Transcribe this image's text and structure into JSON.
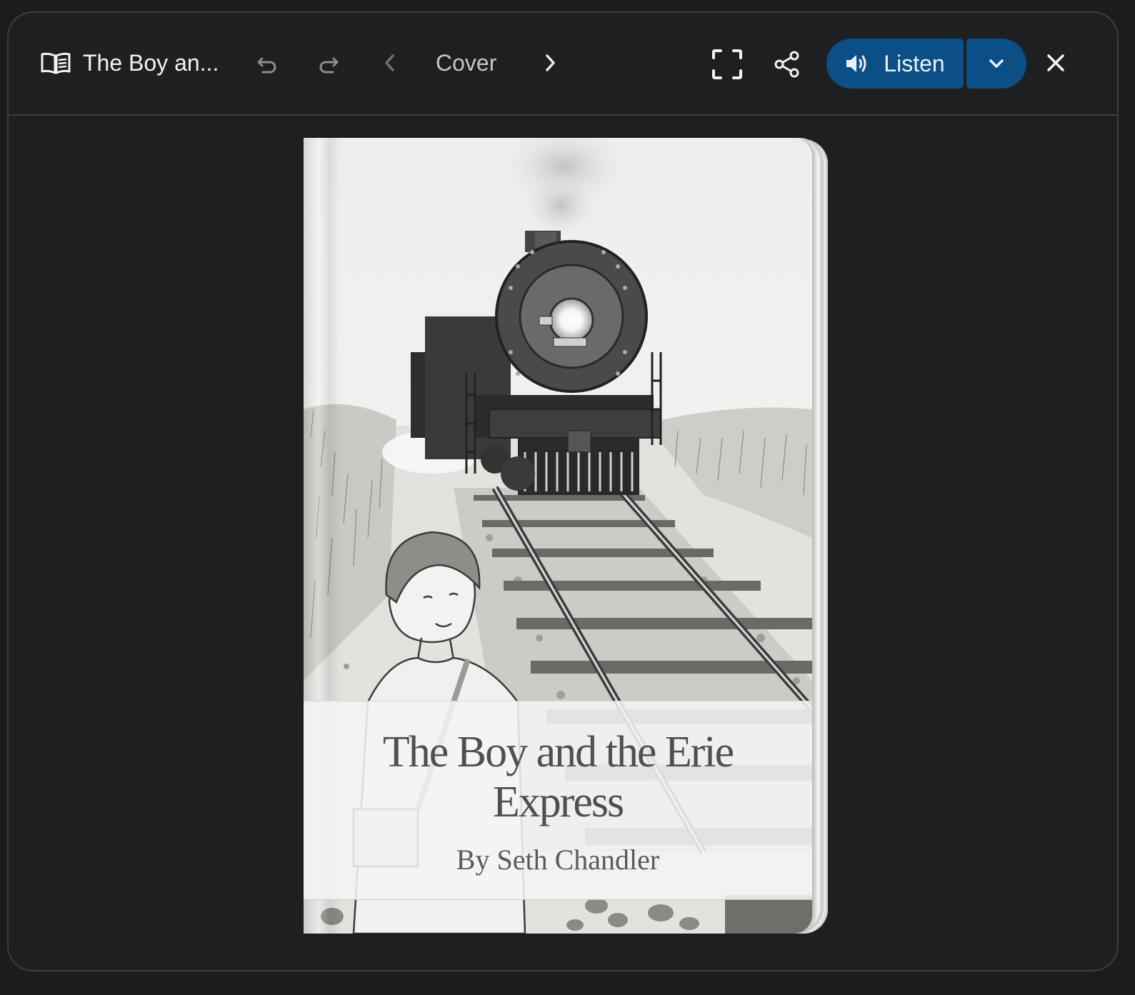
{
  "toolbar": {
    "book_title": "The Boy an...",
    "page_label": "Cover",
    "listen_label": "Listen",
    "icons": {
      "book": "open-book-icon",
      "undo": "undo-icon",
      "redo": "redo-icon",
      "prev": "chevron-left-icon",
      "next": "chevron-right-icon",
      "fullscreen": "fullscreen-icon",
      "share": "share-icon",
      "listen": "speaker-icon",
      "dropdown": "chevron-down-icon",
      "close": "close-icon"
    }
  },
  "cover": {
    "title": "The Boy and the Erie Express",
    "author": "By Seth Chandler",
    "illustration": "pencil-sketch-boy-and-steam-locomotive"
  },
  "colors": {
    "background": "#1b1c1e",
    "accent": "#0b4f86",
    "border": "#3b3d41"
  }
}
